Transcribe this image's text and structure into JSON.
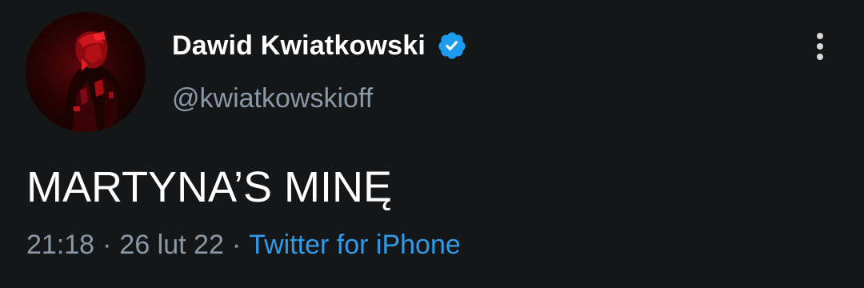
{
  "tweet": {
    "author": {
      "display_name": "Dawid Kwiatkowski",
      "handle": "@kwiatkowskioff",
      "verified_icon": "verified-badge-icon"
    },
    "more_icon": "more-options-icon",
    "text": "MARTYNA’S MINĘ",
    "time": "21:18",
    "separator": "·",
    "date": "26 lut 22",
    "source": "Twitter for iPhone"
  },
  "colors": {
    "background": "#151617",
    "text_primary": "#ffffff",
    "text_secondary": "#8b98a5",
    "link": "#2f9be8",
    "verified": "#1d9bf0",
    "avatar_red": "#c4001a"
  }
}
